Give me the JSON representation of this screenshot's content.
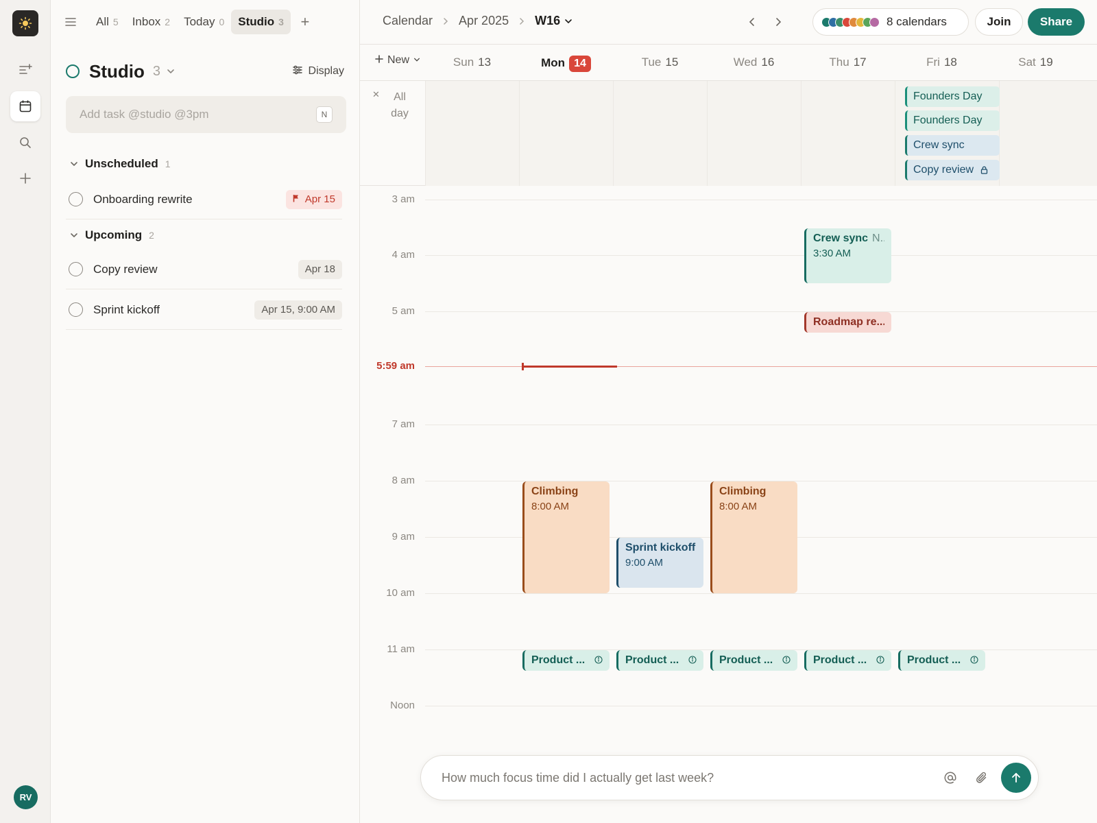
{
  "rail": {
    "logo_icon": "sun-icon",
    "items": [
      {
        "name": "tasks-icon",
        "active": false
      },
      {
        "name": "calendar-icon",
        "active": true
      },
      {
        "name": "search-icon",
        "active": false
      },
      {
        "name": "plus-icon",
        "active": false
      }
    ],
    "avatar": "RV"
  },
  "tabs": [
    {
      "label": "All",
      "count": "5"
    },
    {
      "label": "Inbox",
      "count": "2"
    },
    {
      "label": "Today",
      "count": "0"
    },
    {
      "label": "Studio",
      "count": "3",
      "active": true
    }
  ],
  "panel": {
    "title": "Studio",
    "count": "3",
    "display_label": "Display",
    "add_task_placeholder": "Add task @studio @3pm",
    "shortcut": "N"
  },
  "sections": [
    {
      "name": "Unscheduled",
      "count": "1",
      "tasks": [
        {
          "name": "Onboarding rewrite",
          "date": "Apr 15",
          "flagged": true
        }
      ]
    },
    {
      "name": "Upcoming",
      "count": "2",
      "tasks": [
        {
          "name": "Copy review",
          "date": "Apr 18",
          "flagged": false
        },
        {
          "name": "Sprint kickoff",
          "date": "Apr 15, 9:00 AM",
          "flagged": false
        }
      ]
    }
  ],
  "calendar": {
    "breadcrumb": [
      "Calendar",
      "Apr 2025",
      "W16"
    ],
    "calendars_label": "8 calendars",
    "calendar_colors": [
      "#1b7a6c",
      "#2f6fa3",
      "#3b8f6a",
      "#d9473a",
      "#e08a3c",
      "#e3b73b",
      "#5aa55a",
      "#b56aa3"
    ],
    "join_label": "Join",
    "share_label": "Share",
    "new_label": "New",
    "days": [
      {
        "dow": "Sun",
        "num": "13"
      },
      {
        "dow": "Mon",
        "num": "14",
        "today": true
      },
      {
        "dow": "Tue",
        "num": "15"
      },
      {
        "dow": "Wed",
        "num": "16"
      },
      {
        "dow": "Thu",
        "num": "17"
      },
      {
        "dow": "Fri",
        "num": "18"
      },
      {
        "dow": "Sat",
        "num": "19"
      }
    ],
    "allday_label": "All day",
    "allday_events": [
      {
        "title": "Founders Day",
        "style": "green"
      },
      {
        "title": "Founders Day",
        "style": "green"
      },
      {
        "title": "Crew sync",
        "style": "blue"
      },
      {
        "title": "Copy review",
        "style": "blue",
        "locked": true
      }
    ],
    "hours": [
      "3 am",
      "4 am",
      "5 am",
      "7 am",
      "8 am",
      "9 am",
      "10 am",
      "11 am",
      "Noon"
    ],
    "now_label": "5:59 am",
    "events": [
      {
        "day": 4,
        "title": "Crew sync",
        "extra": "N..",
        "time": "3:30 AM",
        "style": "teal",
        "start": 3.5,
        "end": 4.5
      },
      {
        "day": 4,
        "title": "Roadmap re...",
        "style": "red",
        "pill": true,
        "start": 5.0
      },
      {
        "day": 1,
        "title": "Climbing",
        "time": "8:00 AM",
        "style": "orange",
        "start": 8.0,
        "end": 10.0
      },
      {
        "day": 2,
        "title": "Sprint kickoff",
        "time": "9:00 AM",
        "style": "blue",
        "start": 9.0,
        "end": 9.9
      },
      {
        "day": 3,
        "title": "Climbing",
        "time": "8:00 AM",
        "style": "orange",
        "start": 8.0,
        "end": 10.0
      },
      {
        "day": 1,
        "title": "Product ...",
        "style": "teal",
        "pill": true,
        "info": true,
        "start": 11.0
      },
      {
        "day": 2,
        "title": "Product ...",
        "style": "teal",
        "pill": true,
        "info": true,
        "start": 11.0
      },
      {
        "day": 3,
        "title": "Product ...",
        "style": "teal",
        "pill": true,
        "info": true,
        "start": 11.0
      },
      {
        "day": 4,
        "title": "Product ...",
        "style": "teal",
        "pill": true,
        "info": true,
        "start": 11.0
      },
      {
        "day": 5,
        "title": "Product ...",
        "style": "teal",
        "pill": true,
        "info": true,
        "start": 11.0
      }
    ]
  },
  "chat": {
    "placeholder": "How much focus time did I actually get last week?"
  }
}
